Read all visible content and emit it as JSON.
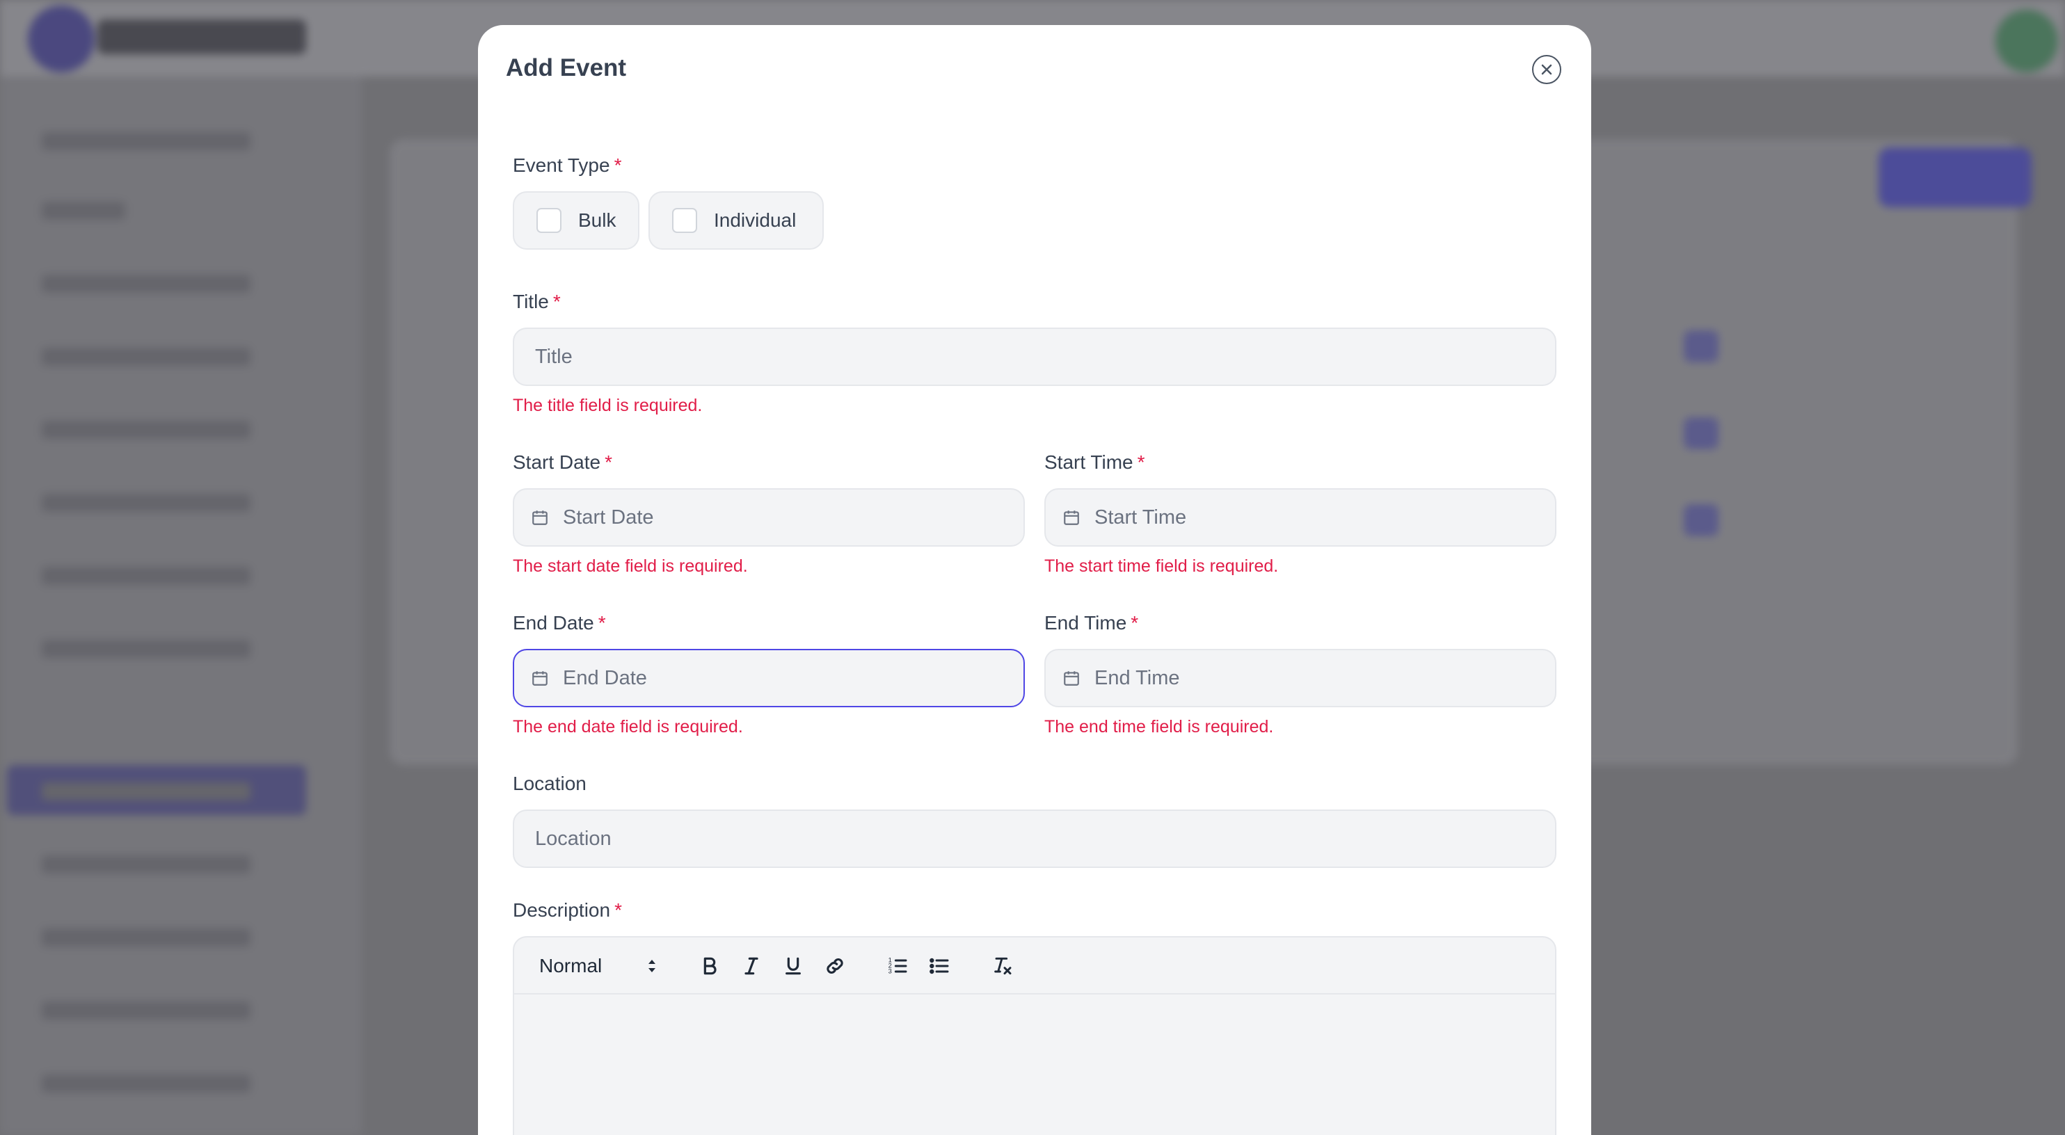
{
  "modal": {
    "title": "Add Event"
  },
  "event_type": {
    "label": "Event Type",
    "required_mark": "*",
    "options": [
      {
        "label": "Bulk",
        "checked": false
      },
      {
        "label": "Individual",
        "checked": false
      }
    ]
  },
  "title_field": {
    "label": "Title",
    "required_mark": "*",
    "placeholder": "Title",
    "value": "",
    "error": "The title field is required."
  },
  "start_date": {
    "label": "Start Date",
    "required_mark": "*",
    "placeholder": "Start Date",
    "error": "The start date field is required.",
    "icon": "calendar-icon"
  },
  "start_time": {
    "label": "Start Time",
    "required_mark": "*",
    "placeholder": "Start Time",
    "error": "The start time field is required.",
    "icon": "calendar-icon"
  },
  "end_date": {
    "label": "End Date",
    "required_mark": "*",
    "placeholder": "End Date",
    "error": "The end date field is required.",
    "icon": "calendar-icon",
    "focused": true
  },
  "end_time": {
    "label": "End Time",
    "required_mark": "*",
    "placeholder": "End Time",
    "error": "The end time field is required.",
    "icon": "calendar-icon"
  },
  "location": {
    "label": "Location",
    "placeholder": "Location",
    "value": ""
  },
  "description": {
    "label": "Description",
    "required_mark": "*",
    "toolbar": {
      "format_select": "Normal",
      "buttons": [
        "bold-icon",
        "italic-icon",
        "underline-icon",
        "link-icon",
        "ordered-list-icon",
        "bullet-list-icon",
        "clear-format-icon"
      ]
    }
  },
  "colors": {
    "accent": "#4f46e5",
    "error": "#e11d48",
    "field_bg": "#f3f4f6"
  }
}
